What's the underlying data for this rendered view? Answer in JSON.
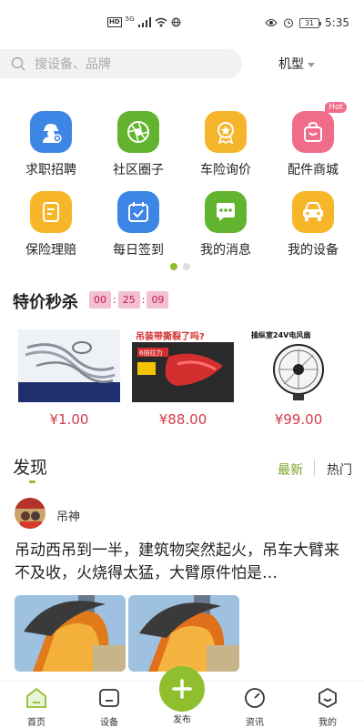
{
  "status_bar": {
    "net_badge": "HD",
    "net_type": "5G",
    "battery": "31",
    "time": "5:35"
  },
  "search": {
    "placeholder": "搜设备、品牌"
  },
  "filter": {
    "label": "机型"
  },
  "grid": {
    "items": [
      {
        "label": "求职招聘",
        "color": "#3d86e6",
        "icon": "job-icon"
      },
      {
        "label": "社区圈子",
        "color": "#62b32d",
        "icon": "camera-aperture-icon"
      },
      {
        "label": "车险询价",
        "color": "#f5b52a",
        "icon": "medal-icon"
      },
      {
        "label": "配件商城",
        "color": "#f06d8a",
        "icon": "shopping-bag-icon",
        "badge": "Hot"
      },
      {
        "label": "保险理赔",
        "color": "#f7b62a",
        "icon": "document-icon"
      },
      {
        "label": "每日签到",
        "color": "#3d86e6",
        "icon": "calendar-check-icon"
      },
      {
        "label": "我的消息",
        "color": "#62b32d",
        "icon": "chat-icon"
      },
      {
        "label": "我的设备",
        "color": "#f7b62a",
        "icon": "car-icon"
      }
    ]
  },
  "flash_sale": {
    "title": "特价秒杀",
    "timer": [
      "00",
      "25",
      "09"
    ],
    "products": [
      {
        "price": "¥1.00",
        "image_text": ""
      },
      {
        "price": "¥88.00",
        "image_text": "吊装带撕裂了吗?",
        "image_sub": "6倍拉力"
      },
      {
        "price": "¥99.00",
        "image_text": "操纵室24V电风扇"
      }
    ]
  },
  "discover": {
    "title": "发现",
    "tabs": {
      "latest": "最新",
      "hot": "热门"
    },
    "post": {
      "author": "吊神",
      "text": "吊动西吊到一半，建筑物突然起火，吊车大臂来不及收，火烧得太猛，大臂原件怕是…"
    }
  },
  "bottom_nav": {
    "home": "首页",
    "equipment": "设备",
    "publish": "发布",
    "news": "资讯",
    "mine": "我的"
  },
  "colors": {
    "accent": "#8fbf2f",
    "price": "#d33a4a",
    "timer_bg": "#f3c0cf"
  }
}
